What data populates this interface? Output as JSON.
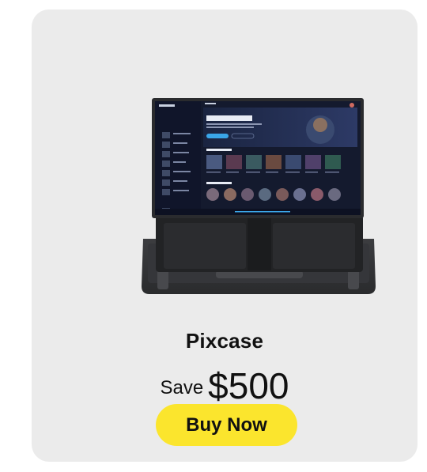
{
  "product": {
    "name": "Pixcase",
    "price_prefix": "Save",
    "price_amount": "$500",
    "cta_label": "Buy Now"
  },
  "screen": {
    "app_name": "Playlist",
    "featured_title": "Flume: Skin",
    "section_albums": "Popular Albums",
    "section_artists": "Popular Artists"
  },
  "colors": {
    "card_bg": "#ebebeb",
    "cta_bg": "#fbe52d",
    "screen_bg": "#141a2e",
    "accent": "#3aa6e8"
  }
}
